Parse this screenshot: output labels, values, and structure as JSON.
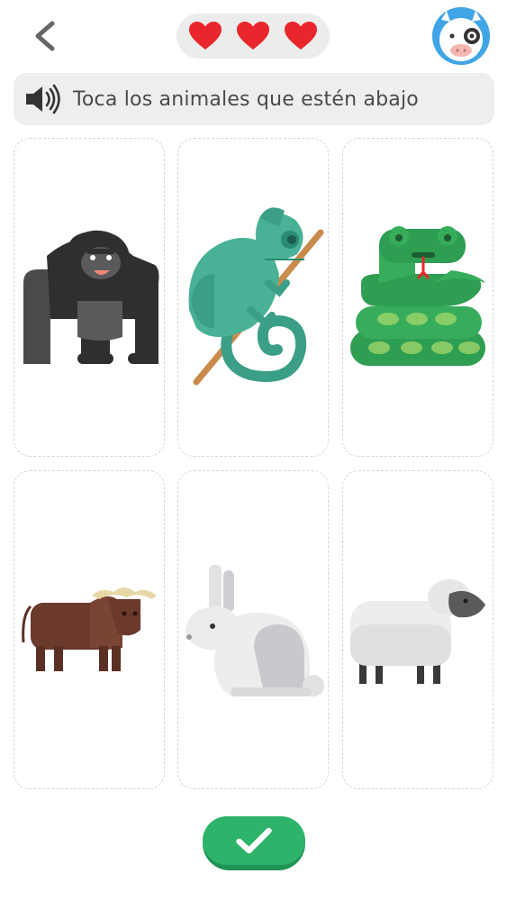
{
  "header": {
    "back_icon": "chevron-left-icon",
    "lives": {
      "count": 3,
      "icon": "heart-icon",
      "color": "#e8262c"
    },
    "avatar_icon": "cow-avatar-icon"
  },
  "instruction": {
    "icon": "speaker-icon",
    "text": "Toca los animales que estén abajo"
  },
  "cards": [
    {
      "animal": "gorilla"
    },
    {
      "animal": "chameleon"
    },
    {
      "animal": "snake"
    },
    {
      "animal": "buffalo"
    },
    {
      "animal": "rabbit"
    },
    {
      "animal": "sheep"
    }
  ],
  "check_button": {
    "icon": "checkmark-icon",
    "color": "#2db36a"
  }
}
